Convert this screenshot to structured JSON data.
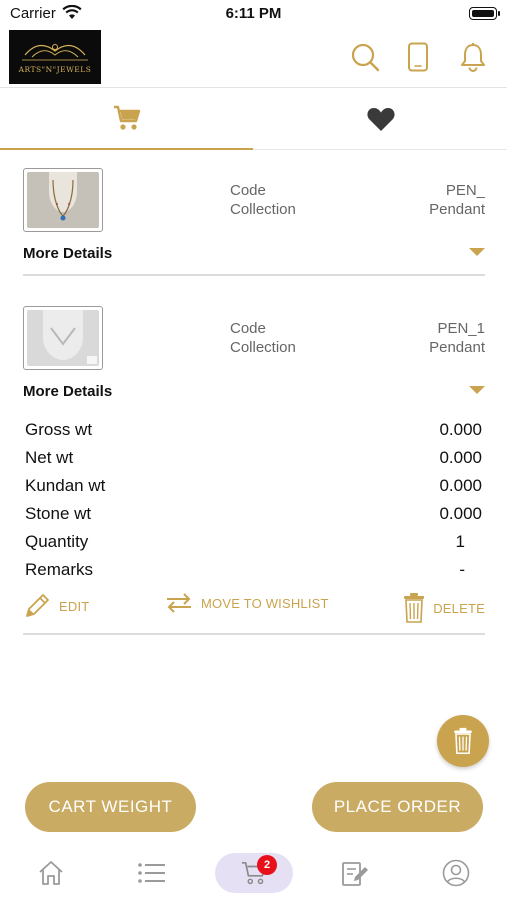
{
  "status_bar": {
    "carrier": "Carrier",
    "time": "6:11 PM"
  },
  "header": {
    "logo_text": "ARTS\"N\"JEWELS"
  },
  "items": [
    {
      "code_label": "Code",
      "collection_label": "Collection",
      "code_value": "PEN_",
      "collection_value": "Pendant",
      "more_details": "More Details"
    },
    {
      "code_label": "Code",
      "collection_label": "Collection",
      "code_value": "PEN_1",
      "collection_value": "Pendant",
      "more_details": "More Details"
    }
  ],
  "details": [
    {
      "label": "Gross wt",
      "value": "0.000"
    },
    {
      "label": "Net wt",
      "value": "0.000"
    },
    {
      "label": "Kundan wt",
      "value": "0.000"
    },
    {
      "label": "Stone wt",
      "value": "0.000"
    },
    {
      "label": "Quantity",
      "value": "1"
    },
    {
      "label": "Remarks",
      "value": "-"
    }
  ],
  "actions": {
    "edit": "EDIT",
    "move": "MOVE TO WISHLIST",
    "delete": "DELETE"
  },
  "buttons": {
    "cart_weight": "CART WEIGHT",
    "place_order": "PLACE ORDER"
  },
  "tabbar": {
    "cart_badge": "2"
  },
  "colors": {
    "accent": "#c9a34e",
    "button": "#c9ab63",
    "badge": "#e8101a",
    "active_tab_bg": "#e6e0f5"
  }
}
